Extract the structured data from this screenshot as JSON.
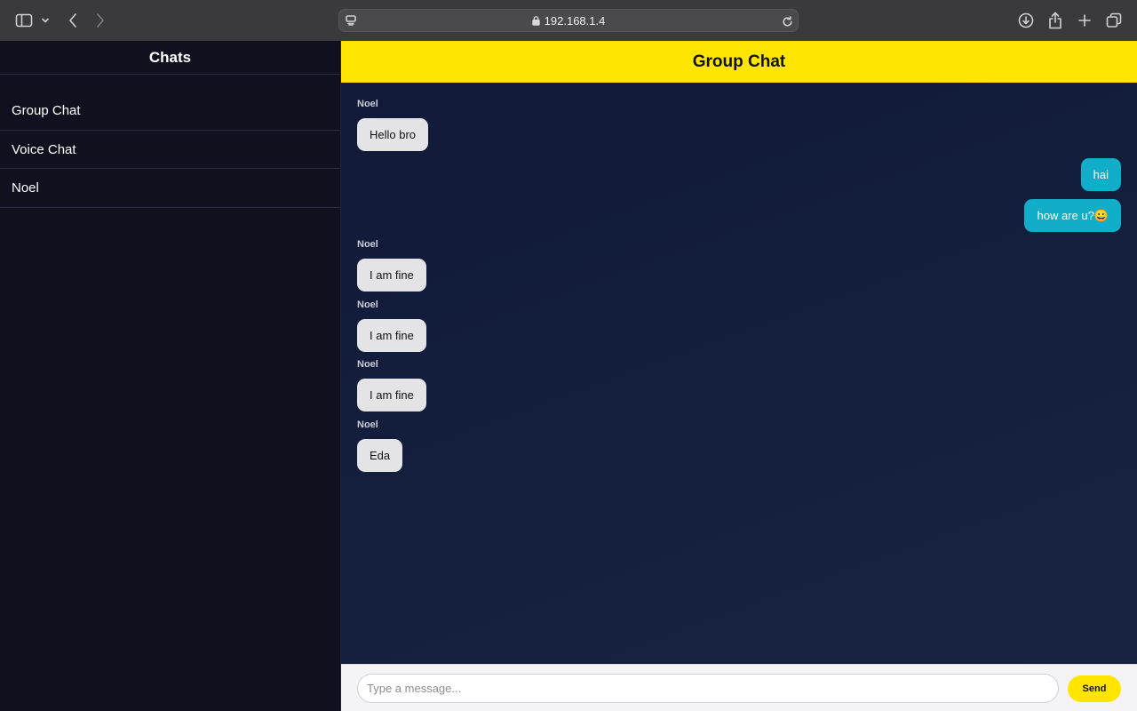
{
  "browser": {
    "url": "192.168.1.4"
  },
  "sidebar": {
    "title": "Chats",
    "items": [
      {
        "label": "Group Chat"
      },
      {
        "label": "Voice Chat"
      },
      {
        "label": "Noel"
      }
    ]
  },
  "chat": {
    "title": "Group Chat",
    "messages": [
      {
        "sender": "Noel",
        "text": "Hello bro",
        "direction": "incoming"
      },
      {
        "text": "hai",
        "direction": "outgoing"
      },
      {
        "text": "how are u?😀",
        "direction": "outgoing"
      },
      {
        "sender": "Noel",
        "text": "I am fine",
        "direction": "incoming"
      },
      {
        "sender": "Noel",
        "text": "I am fine",
        "direction": "incoming"
      },
      {
        "sender": "Noel",
        "text": "I am fine",
        "direction": "incoming"
      },
      {
        "sender": "Noel",
        "text": "Eda",
        "direction": "incoming"
      }
    ]
  },
  "composer": {
    "placeholder": "Type a message...",
    "value": "",
    "send_label": "Send"
  },
  "colors": {
    "header_accent": "#ffe500",
    "outgoing_bubble": "#12aec9",
    "incoming_bubble": "#e4e4e6",
    "sidebar_bg": "#10101f",
    "messages_bg": "#131d3c"
  }
}
